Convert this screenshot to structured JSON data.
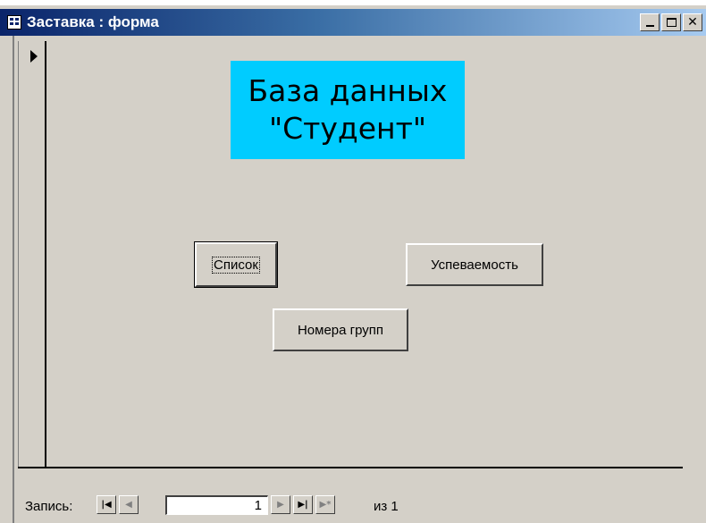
{
  "window": {
    "title": "Заставка : форма",
    "icon": "form-icon"
  },
  "banner": {
    "line1": "База данных",
    "line2": "\"Студент\"",
    "background": "#00ccff"
  },
  "buttons": {
    "list": "Список",
    "progress": "Успеваемость",
    "groups": "Номера групп"
  },
  "navigation": {
    "label": "Запись:",
    "current": "1",
    "of_text": "из  1"
  },
  "colors": {
    "title_gradient_start": "#0a246a",
    "title_gradient_end": "#a6caf0",
    "face": "#d4d0c8"
  }
}
